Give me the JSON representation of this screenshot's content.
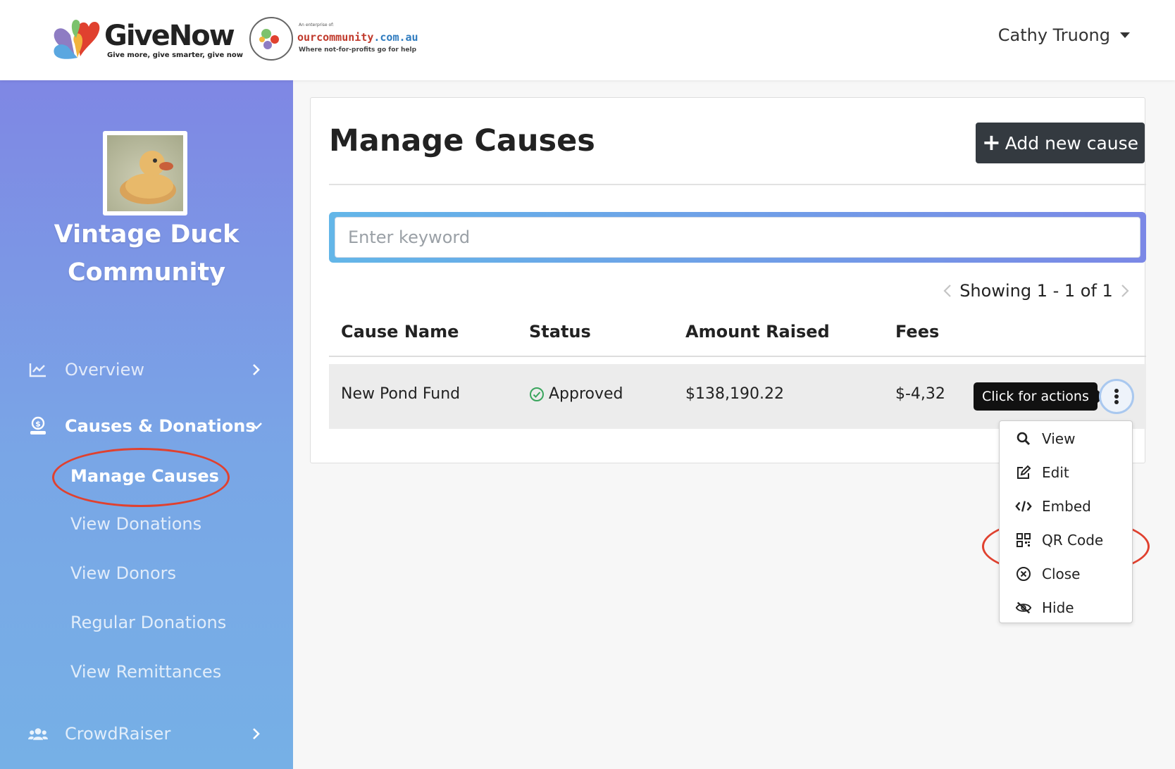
{
  "header": {
    "brand_name": "GiveNow",
    "brand_tagline": "Give more, give smarter, give now",
    "partner_prefix": "An enterprise of:",
    "partner_name_part1": "ourcommunity",
    "partner_name_part2": ".com.au",
    "partner_tagline": "Where not-for-profits go for help",
    "user_name": "Cathy Truong"
  },
  "sidebar": {
    "org_name_line1": "Vintage Duck",
    "org_name_line2": "Community",
    "nav": {
      "overview": "Overview",
      "causes_donations": "Causes & Donations",
      "crowdraiser": "CrowdRaiser"
    },
    "sub_items": {
      "manage_causes": "Manage Causes",
      "view_donations": "View Donations",
      "view_donors": "View Donors",
      "regular_donations": "Regular Donations",
      "view_remittances": "View Remittances"
    }
  },
  "main": {
    "title": "Manage Causes",
    "add_button": "Add new cause",
    "search_placeholder": "Enter keyword",
    "pagination_text": "Showing 1 - 1 of 1",
    "columns": {
      "cause_name": "Cause Name",
      "status": "Status",
      "amount_raised": "Amount Raised",
      "fees": "Fees"
    },
    "rows": [
      {
        "cause_name": "New Pond Fund",
        "status": "Approved",
        "amount_raised": "$138,190.22",
        "fees": "$-4,32"
      }
    ],
    "tooltip": "Click for actions",
    "actions_menu": [
      "View",
      "Edit",
      "Embed",
      "QR Code",
      "Close",
      "Hide"
    ]
  },
  "colors": {
    "sidebar_top": "#7f87e4",
    "sidebar_bottom": "#76b0e6",
    "dark_button": "#343a40",
    "highlight_circle": "#e0412f",
    "approved_green": "#3aa55d"
  }
}
